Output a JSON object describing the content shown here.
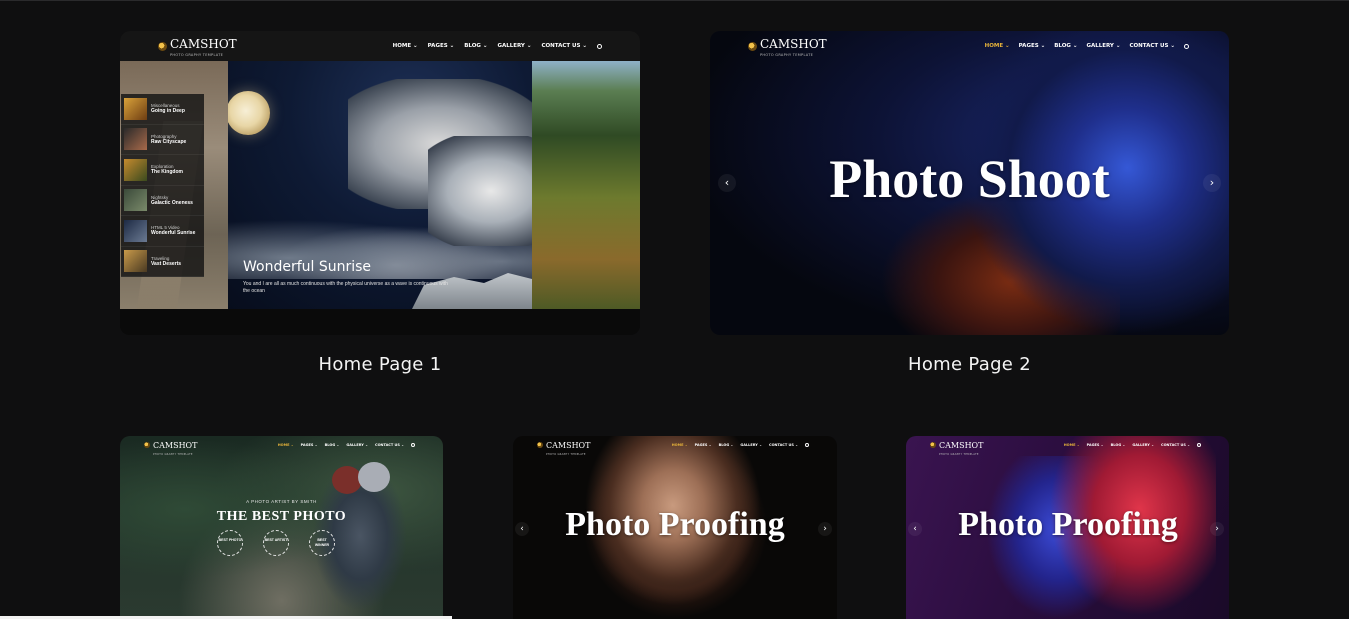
{
  "brand": {
    "name": "CAMSHOT",
    "tagline": "PHOTO GRAPHY TEMPLATE"
  },
  "nav": {
    "items": [
      "HOME",
      "PAGES",
      "BLOG",
      "GALLERY",
      "CONTACT US"
    ],
    "caret": "⌄",
    "search_icon": "search-icon"
  },
  "demos": {
    "home1": {
      "label": "Home Page 1",
      "list": [
        {
          "category": "Miscellaneous",
          "title": "Going in Deep"
        },
        {
          "category": "Photography",
          "title": "Raw Cityscape"
        },
        {
          "category": "Exploration",
          "title": "The Kingdom"
        },
        {
          "category": "Nightsky",
          "title": "Galactic Oneness"
        },
        {
          "category": "HTML 5 Video",
          "title": "Wonderful Sunrise"
        },
        {
          "category": "Traveling",
          "title": "Vast Deserts"
        }
      ],
      "caption_title": "Wonderful Sunrise",
      "caption_text": "You and I are all as much continuous with the physical universe as a wave is continuous with the ocean"
    },
    "home2": {
      "label": "Home Page 2",
      "headline": "Photo Shoot",
      "prev": "‹",
      "next": "›"
    },
    "home3": {
      "kicker": "A PHOTO ARTIST BY SMITH",
      "headline": "THE BEST PHOTO",
      "badges": [
        "BEST PHOTO",
        "BEST ARTIST",
        "BEST WINNER"
      ]
    },
    "home4": {
      "headline": "Photo Proofing",
      "prev": "‹",
      "next": "›"
    },
    "home5": {
      "headline": "Photo Proofing",
      "prev": "‹",
      "next": "›"
    }
  },
  "colors": {
    "background": "#0f0f10",
    "accent": "#e6b33a",
    "text": "#ffffff"
  }
}
